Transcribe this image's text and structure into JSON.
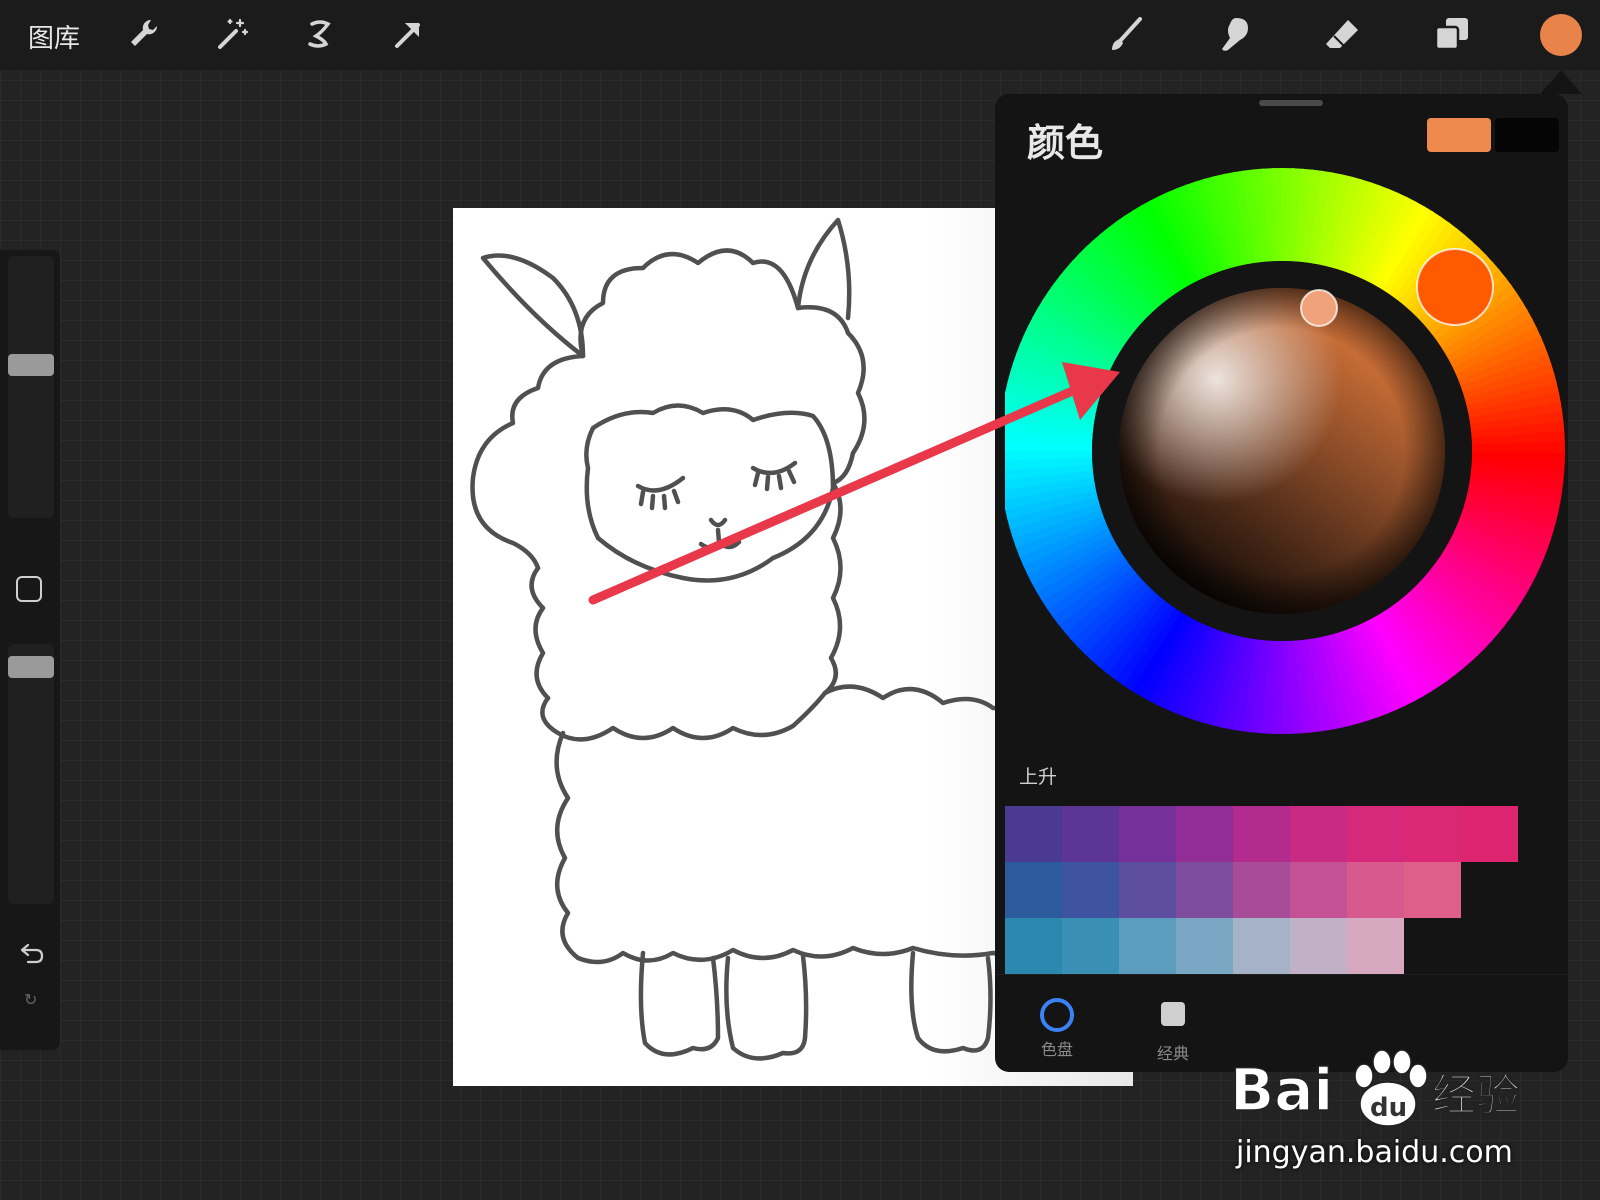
{
  "topbar": {
    "gallery_label": "图库",
    "tools_left": [
      "wrench-icon",
      "magic-wand-icon",
      "selection-icon",
      "transform-arrow-icon"
    ],
    "tools_right": [
      "brush-icon",
      "smudge-icon",
      "eraser-icon",
      "layers-icon"
    ],
    "current_color": "#E8834A"
  },
  "color_panel": {
    "title": "颜色",
    "primary_color": "#EE8A4E",
    "secondary_color": "#050505",
    "palette_label": "上升",
    "palette_rows": [
      [
        "#4A3A92",
        "#5C3597",
        "#76309A",
        "#922C96",
        "#B22C8E",
        "#C92A84",
        "#D6297C",
        "#DB2874",
        "#DE2670"
      ],
      [
        "#2E5B9E",
        "#3E54A0",
        "#5D4E9F",
        "#7E4D9D",
        "#A84C98",
        "#C35193",
        "#D65A8E",
        "#DE5F8A"
      ],
      [
        "#2D88B0",
        "#3990B4",
        "#5C9CBC",
        "#7AA7C3",
        "#A6B2C8",
        "#C0B1C6",
        "#D7A9BF"
      ]
    ],
    "tabs": [
      {
        "label": "色盘",
        "active": true
      },
      {
        "label": "经典",
        "active": false
      }
    ]
  },
  "watermark": {
    "brand": "Bai",
    "brand_du": "du",
    "brand_cn": "经验",
    "url": "jingyan.baidu.com"
  }
}
